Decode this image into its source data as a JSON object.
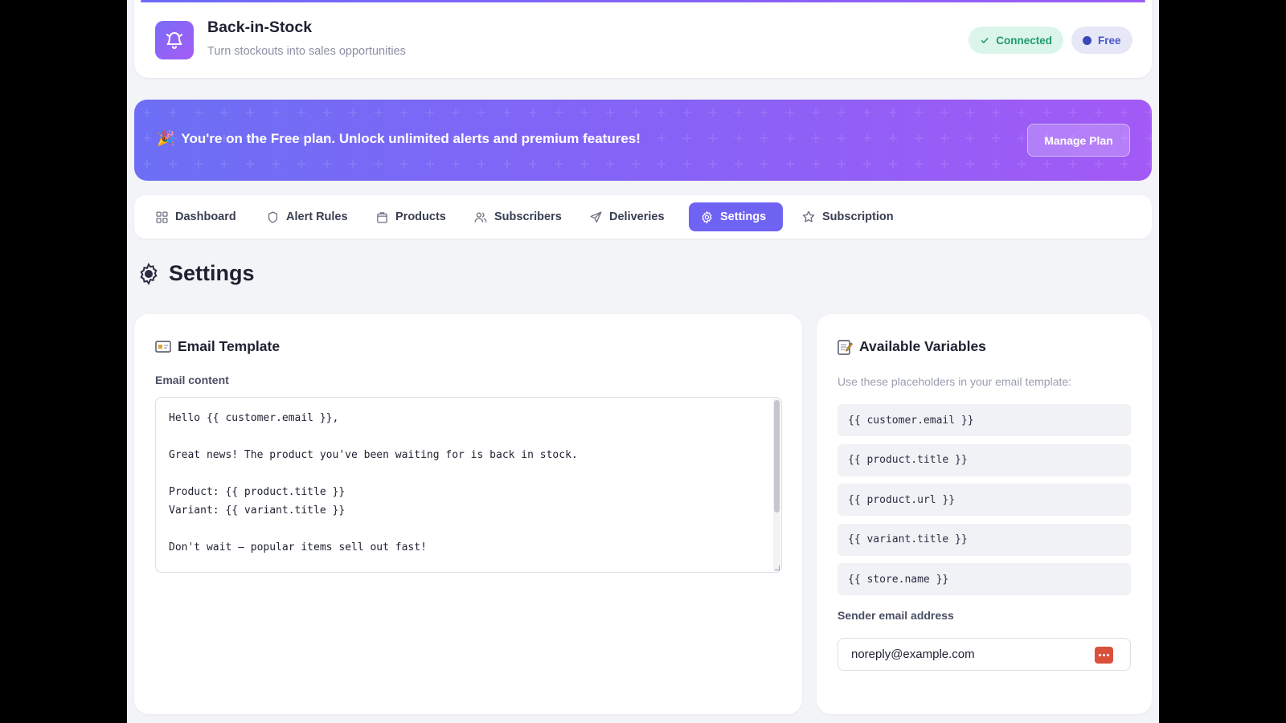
{
  "header": {
    "title": "Back-in-Stock",
    "subtitle": "Turn stockouts into sales opportunities",
    "icon": "bell-icon",
    "status_connected": "Connected",
    "plan_badge": "Free"
  },
  "banner": {
    "prefix": "You're on the ",
    "plan": "Free",
    "suffix": " plan. Unlock unlimited alerts and premium features!",
    "button": "Manage Plan"
  },
  "nav": {
    "items": [
      {
        "label": "Dashboard",
        "icon": "grid-icon"
      },
      {
        "label": "Alert Rules",
        "icon": "shield-icon"
      },
      {
        "label": "Products",
        "icon": "bag-icon"
      },
      {
        "label": "Subscribers",
        "icon": "users-icon"
      },
      {
        "label": "Deliveries",
        "icon": "send-icon"
      },
      {
        "label": "Settings",
        "icon": "gear-icon",
        "active": true
      },
      {
        "label": "Subscription",
        "icon": "star-icon"
      }
    ]
  },
  "page": {
    "title": "Settings"
  },
  "email_card": {
    "title": "Email Template",
    "content_label": "Email content",
    "content": "Hello {{ customer.email }},\n\nGreat news! The product you've been waiting for is back in stock.\n\nProduct: {{ product.title }}\nVariant: {{ variant.title }}\n\nDon't wait – popular items sell out fast!"
  },
  "vars_card": {
    "title": "Available Variables",
    "hint": "Use these placeholders in your email template:",
    "variables": [
      "{{ customer.email }}",
      "{{ product.title }}",
      "{{ product.url }}",
      "{{ variant.title }}",
      "{{ store.name }}"
    ],
    "sender_label": "Sender email address",
    "sender_value": "noreply@example.com"
  },
  "colors": {
    "accent": "#6f63f3",
    "connected": "#1f9b6a",
    "banner_start": "#6c6ff5",
    "banner_end": "#a35af6"
  }
}
